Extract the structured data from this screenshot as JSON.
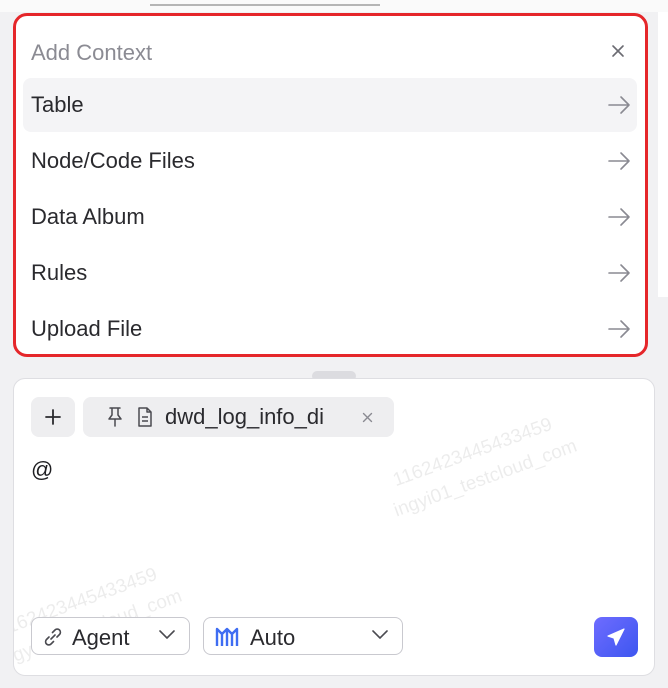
{
  "popup": {
    "title": "Add Context",
    "items": [
      {
        "label": "Table",
        "active": true
      },
      {
        "label": "Node/Code Files",
        "active": false
      },
      {
        "label": "Data Album",
        "active": false
      },
      {
        "label": "Rules",
        "active": false
      },
      {
        "label": "Upload File",
        "active": false
      }
    ]
  },
  "composer": {
    "chip_label": "dwd_log_info_di",
    "input_text": "@",
    "watermark_id": "1162423445433459",
    "watermark_user": "ingyi01_testcloud_com",
    "model_select": {
      "label": "Agent"
    },
    "mode_select": {
      "label": "Auto"
    }
  },
  "colors": {
    "highlight_border": "#e5262a",
    "send_button": "#4b5cf3",
    "auto_icon": "#3f6df2"
  }
}
